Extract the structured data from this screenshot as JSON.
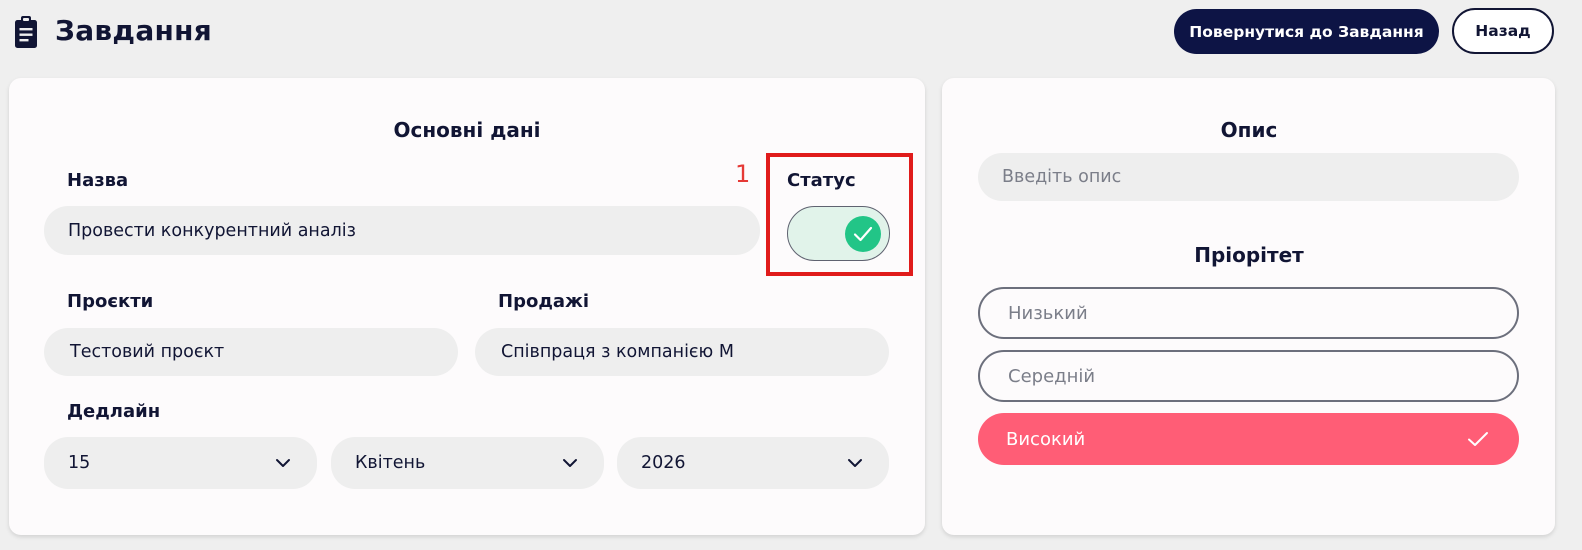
{
  "header": {
    "title": "Завдання",
    "back_to_tasks_label": "Повернутися до Завдання",
    "back_label": "Назад"
  },
  "main": {
    "section_title": "Основні дані",
    "name_label": "Назва",
    "name_value": "Провести конкурентний аналіз",
    "marker": "1",
    "status_label": "Статус",
    "status_on": true,
    "projects_label": "Проєкти",
    "projects_value": "Тестовий проєкт",
    "sales_label": "Продажі",
    "sales_value": "Співпраця з компанією М",
    "deadline_label": "Дедлайн",
    "deadline_day": "15",
    "deadline_month": "Квітень",
    "deadline_year": "2026"
  },
  "side": {
    "description_title": "Опис",
    "description_placeholder": "Введіть опис",
    "priority_title": "Пріорітет",
    "priorities": [
      {
        "label": "Низький",
        "selected": false
      },
      {
        "label": "Середній",
        "selected": false
      },
      {
        "label": "Високий",
        "selected": true
      }
    ]
  },
  "colors": {
    "navy": "#0d1445",
    "accent_pink": "#ff5d76",
    "toggle_green": "#22c587",
    "highlight_red": "#e01b1b"
  }
}
